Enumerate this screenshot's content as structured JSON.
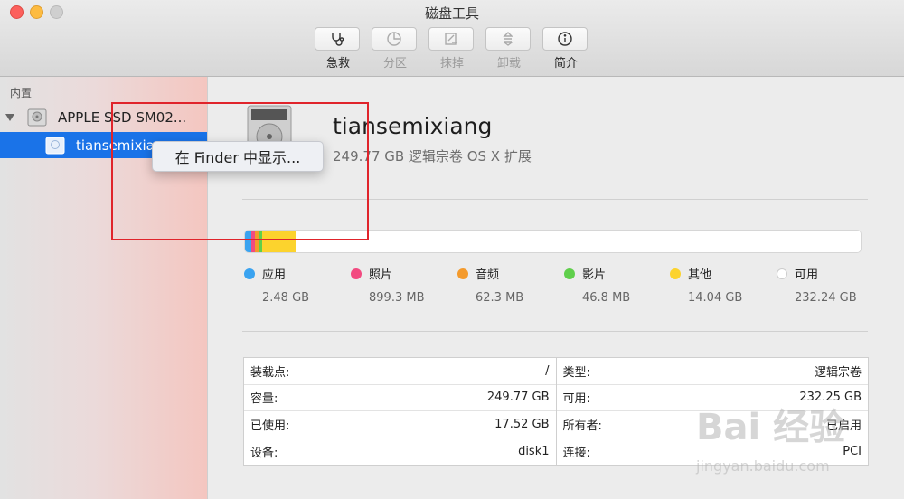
{
  "window": {
    "title": "磁盘工具"
  },
  "toolbar": [
    {
      "id": "firstaid",
      "label": "急救",
      "icon": "stethoscope-icon",
      "enabled": true
    },
    {
      "id": "partition",
      "label": "分区",
      "icon": "pie-partition-icon",
      "enabled": false
    },
    {
      "id": "erase",
      "label": "抹掉",
      "icon": "erase-icon",
      "enabled": false
    },
    {
      "id": "unmount",
      "label": "卸载",
      "icon": "unmount-icon",
      "enabled": false
    },
    {
      "id": "info",
      "label": "简介",
      "icon": "info-icon",
      "enabled": true
    }
  ],
  "sidebar": {
    "section": "内置",
    "disk": {
      "label": "APPLE SSD SM02..."
    },
    "volume": {
      "label": "tiansemixiang"
    }
  },
  "context_menu": {
    "item": "在 Finder 中显示..."
  },
  "volume": {
    "name": "tiansemixiang",
    "subtitle": "249.77 GB 逻辑宗卷 OS X 扩展"
  },
  "usage": [
    {
      "label": "应用",
      "value": "2.48 GB",
      "color": "#3aa3f0",
      "fraction": 0.0099
    },
    {
      "label": "照片",
      "value": "899.3 MB",
      "color": "#f24a80",
      "fraction": 0.0036
    },
    {
      "label": "音频",
      "value": "62.3 MB",
      "color": "#f49a2c",
      "fraction": 0.0004
    },
    {
      "label": "影片",
      "value": "46.8 MB",
      "color": "#5fcf4b",
      "fraction": 0.0003
    },
    {
      "label": "其他",
      "value": "14.04 GB",
      "color": "#fcd32d",
      "fraction": 0.0562
    },
    {
      "label": "可用",
      "value": "232.24 GB",
      "color": "#ffffff",
      "fraction": 0.9296
    }
  ],
  "info_left": [
    {
      "key": "装载点:",
      "value": "/"
    },
    {
      "key": "容量:",
      "value": "249.77 GB"
    },
    {
      "key": "已使用:",
      "value": "17.52 GB"
    },
    {
      "key": "设备:",
      "value": "disk1"
    }
  ],
  "info_right": [
    {
      "key": "类型:",
      "value": "逻辑宗卷"
    },
    {
      "key": "可用:",
      "value": "232.25 GB"
    },
    {
      "key": "所有者:",
      "value": "已启用"
    },
    {
      "key": "连接:",
      "value": "PCI"
    }
  ],
  "watermark": {
    "brand": "Bai 经验",
    "url": "jingyan.baidu.com"
  }
}
